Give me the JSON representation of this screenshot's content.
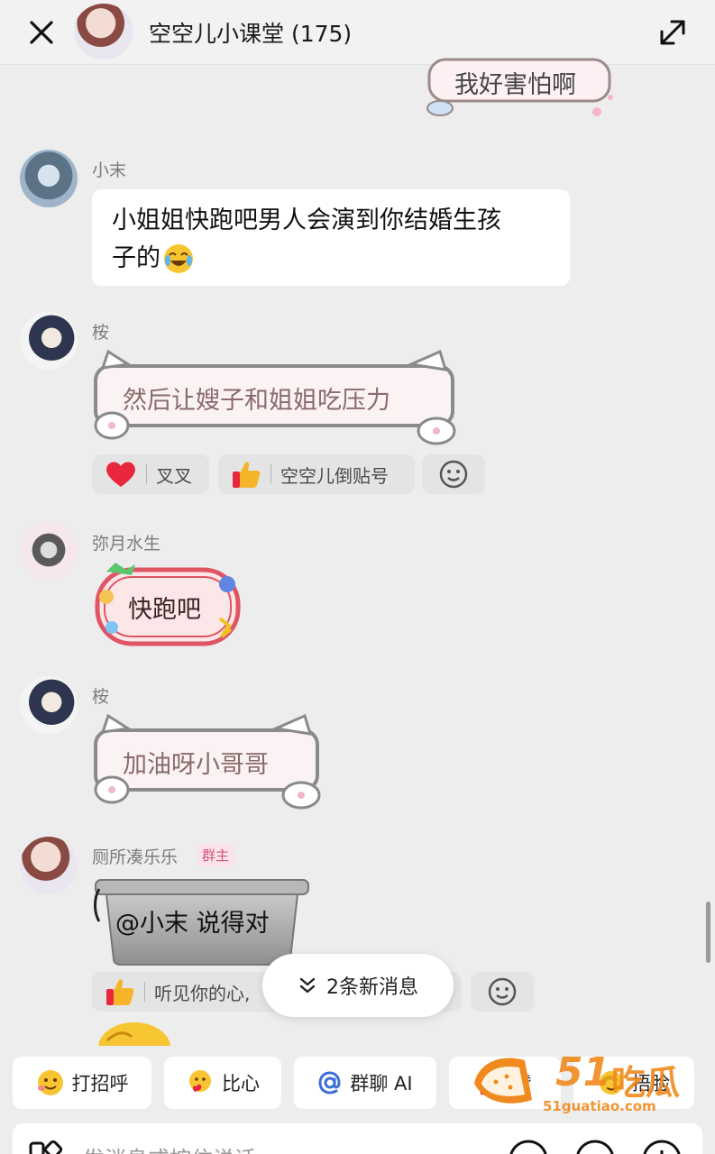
{
  "header": {
    "title": "空空儿小课堂 (175)"
  },
  "messages": {
    "m0": {
      "sticker_text": "我好害怕啊"
    },
    "m1": {
      "sender": "小末",
      "text": "小姐姐快跑吧男人会演到你结婚生孩",
      "text2": "子的"
    },
    "m2": {
      "sender": "桉",
      "sticker_text": "然后让嫂子和姐姐吃压力",
      "reactions": [
        {
          "label": "叉叉",
          "icon": "heart-icon"
        },
        {
          "label": "空空儿倒贴号",
          "icon": "thumbs-up-icon"
        }
      ]
    },
    "m3": {
      "sender": "弥月水生",
      "sticker_text": "快跑吧"
    },
    "m4": {
      "sender": "桉",
      "sticker_text": "加油呀小哥哥"
    },
    "m5": {
      "sender": "厕所凑乐乐",
      "badge": "群主",
      "sticker_text": "@小末 说得对",
      "reactions": [
        {
          "label": "听见你的心,",
          "icon": "thumbs-up-icon"
        }
      ]
    }
  },
  "new_messages": {
    "label": "2条新消息"
  },
  "quick_actions": [
    {
      "label": "打招呼",
      "icon": "wave-emoji-icon"
    },
    {
      "label": "比心",
      "icon": "heart-hands-emoji-icon"
    },
    {
      "label": "群聊 AI",
      "icon": "at-icon"
    },
    {
      "label": "赞",
      "icon": "thumbs-up-emoji-icon"
    },
    {
      "label": "捂脸",
      "icon": "facepalm-emoji-icon"
    }
  ],
  "input": {
    "placeholder": "发消息或按住说话"
  },
  "watermark": {
    "brand": "51",
    "brand_cn": "吃瓜",
    "domain": "51guatiao.com"
  },
  "colors": {
    "accent": "#3a6fd8",
    "cat_border": "#8a8a8a",
    "sticker_red": "#e05563",
    "watermark": "#f08a1e"
  }
}
